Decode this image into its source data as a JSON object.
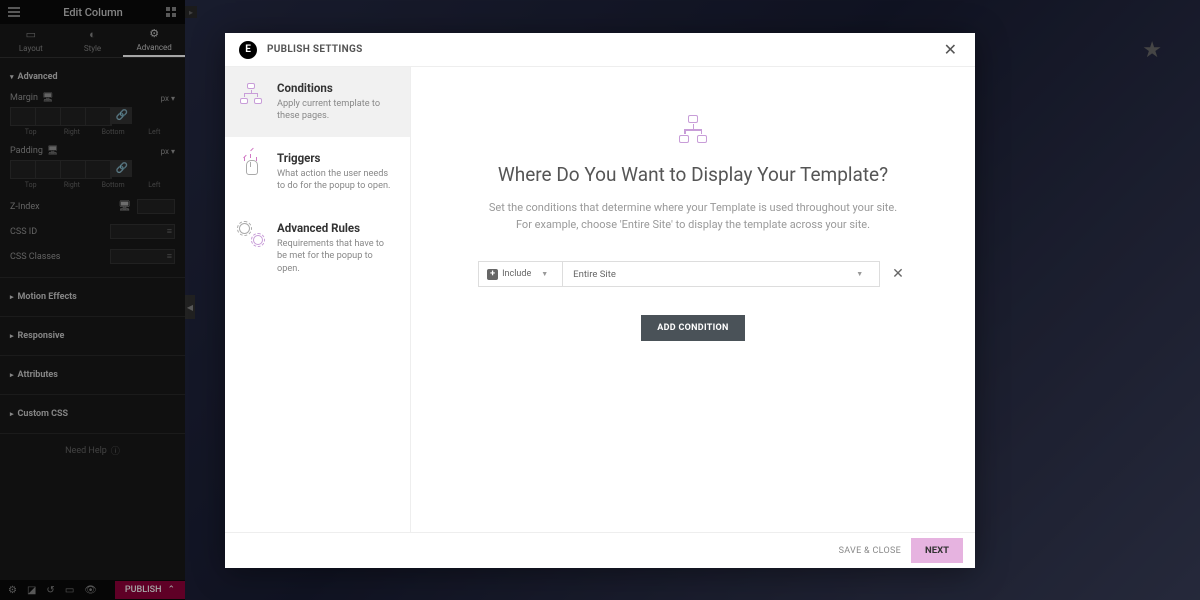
{
  "editor": {
    "header_title": "Edit Column",
    "tabs": {
      "layout": "Layout",
      "style": "Style",
      "advanced": "Advanced"
    },
    "advanced_section": "Advanced",
    "margin_label": "Margin",
    "padding_label": "Padding",
    "unit": "px ▾",
    "sides": {
      "top": "Top",
      "right": "Right",
      "bottom": "Bottom",
      "left": "Left"
    },
    "zindex_label": "Z-Index",
    "cssid_label": "CSS ID",
    "cssclasses_label": "CSS Classes",
    "motion_section": "Motion Effects",
    "responsive_section": "Responsive",
    "attributes_section": "Attributes",
    "customcss_section": "Custom CSS",
    "help": "Need Help",
    "publish": "PUBLISH"
  },
  "modal": {
    "title": "PUBLISH SETTINGS",
    "sidebar": [
      {
        "title": "Conditions",
        "desc": "Apply current template to these pages."
      },
      {
        "title": "Triggers",
        "desc": "What action the user needs to do for the popup to open."
      },
      {
        "title": "Advanced Rules",
        "desc": "Requirements that have to be met for the popup to open."
      }
    ],
    "main_title": "Where Do You Want to Display Your Template?",
    "main_desc_l1": "Set the conditions that determine where your Template is used throughout your site.",
    "main_desc_l2": "For example, choose 'Entire Site' to display the template across your site.",
    "include_label": "Include",
    "condition_value": "Entire Site",
    "add_condition": "ADD CONDITION",
    "save_close": "SAVE & CLOSE",
    "next": "NEXT"
  }
}
